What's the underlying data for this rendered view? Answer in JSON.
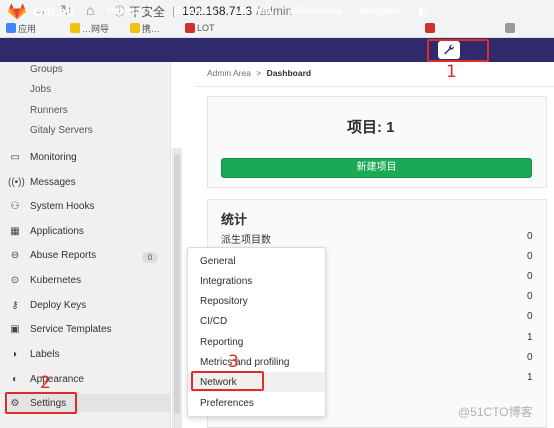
{
  "browser": {
    "back_icon": "back-arrow-icon",
    "forward_icon": "forward-arrow-icon",
    "reload_icon": "reload-icon",
    "home_icon": "home-icon",
    "security_label": "不安全",
    "url_host": "192.168.71.3",
    "url_path": "/admin",
    "bookmarks": [
      "应用",
      "…网导",
      "携…",
      "LOT",
      "",
      ""
    ]
  },
  "header": {
    "brand": "GitLab",
    "menus": [
      {
        "label": "Projects",
        "has_caret": true
      },
      {
        "label": "Groups",
        "has_caret": true
      },
      {
        "label": "Activity",
        "has_caret": false
      },
      {
        "label": "Milestones",
        "has_caret": false
      },
      {
        "label": "Snippets",
        "has_caret": false
      }
    ],
    "accent_color": "#2f2a6b"
  },
  "annotations": {
    "step1": "1",
    "step2": "2",
    "step3": "3",
    "color": "#e02b2b"
  },
  "sidebar": {
    "sub_items": [
      "Groups",
      "Jobs",
      "Runners",
      "Gitaly Servers"
    ],
    "items": [
      {
        "label": "Monitoring",
        "icon": "monitoring-icon"
      },
      {
        "label": "Messages",
        "icon": "messages-icon"
      },
      {
        "label": "System Hooks",
        "icon": "hook-icon"
      },
      {
        "label": "Applications",
        "icon": "applications-icon"
      },
      {
        "label": "Abuse Reports",
        "icon": "abuse-reports-icon",
        "badge": "0"
      },
      {
        "label": "Kubernetes",
        "icon": "kubernetes-icon"
      },
      {
        "label": "Deploy Keys",
        "icon": "key-icon"
      },
      {
        "label": "Service Templates",
        "icon": "service-templates-icon"
      },
      {
        "label": "Labels",
        "icon": "labels-icon"
      },
      {
        "label": "Appearance",
        "icon": "appearance-icon"
      },
      {
        "label": "Settings",
        "icon": "gear-icon"
      }
    ]
  },
  "breadcrumb": {
    "parent": "Admin Area",
    "separator": ">",
    "current": "Dashboard"
  },
  "projects_card": {
    "title": "项目: 1",
    "new_button": "新建项目",
    "button_color": "#1aaa55"
  },
  "stats_card": {
    "title": "统计",
    "label": "派生项目数",
    "values": [
      "0",
      "0",
      "0",
      "0",
      "0",
      "1",
      "0",
      "1"
    ]
  },
  "settings_dropdown": {
    "items": [
      "General",
      "Integrations",
      "Repository",
      "CI/CD",
      "Reporting",
      "Metrics and profiling",
      "Network",
      "Preferences"
    ]
  },
  "watermark": "@51CTO博客"
}
